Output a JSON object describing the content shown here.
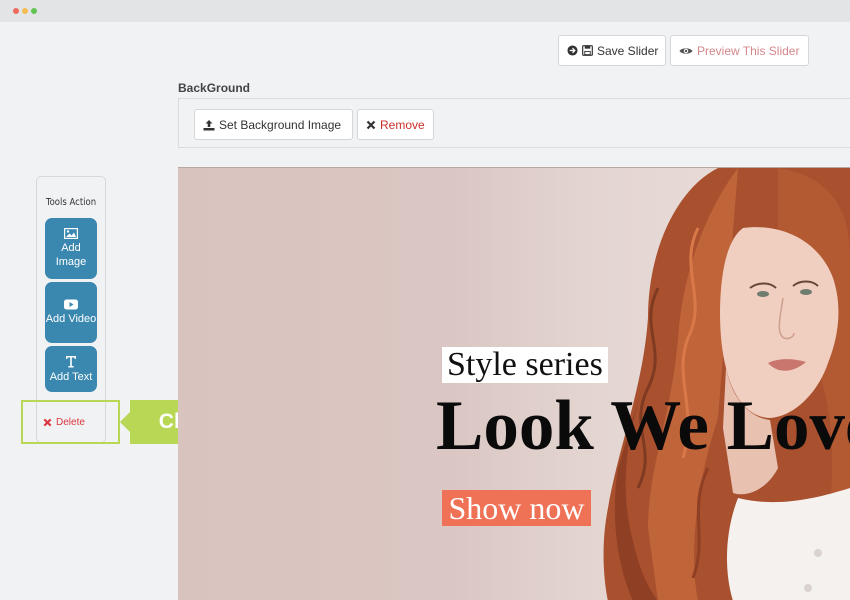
{
  "toolbar": {
    "save_label": "Save Slider",
    "preview_label": "Preview This Slider"
  },
  "background_section": {
    "title": "BackGround",
    "set_label": "Set Background Image",
    "remove_label": "Remove"
  },
  "tools": {
    "title": "Tools Action",
    "add_image": "Add Image",
    "add_video": "Add Video",
    "add_text": "Add Text",
    "delete": "Delete"
  },
  "callout": {
    "label": "Click here"
  },
  "slide": {
    "subtitle": "Style series",
    "headline": "Look We Love",
    "cta": "Show now"
  },
  "colors": {
    "tool_button": "#3a88b0",
    "callout": "#b8d855",
    "danger": "#d9363e",
    "cta": "#f07256"
  }
}
